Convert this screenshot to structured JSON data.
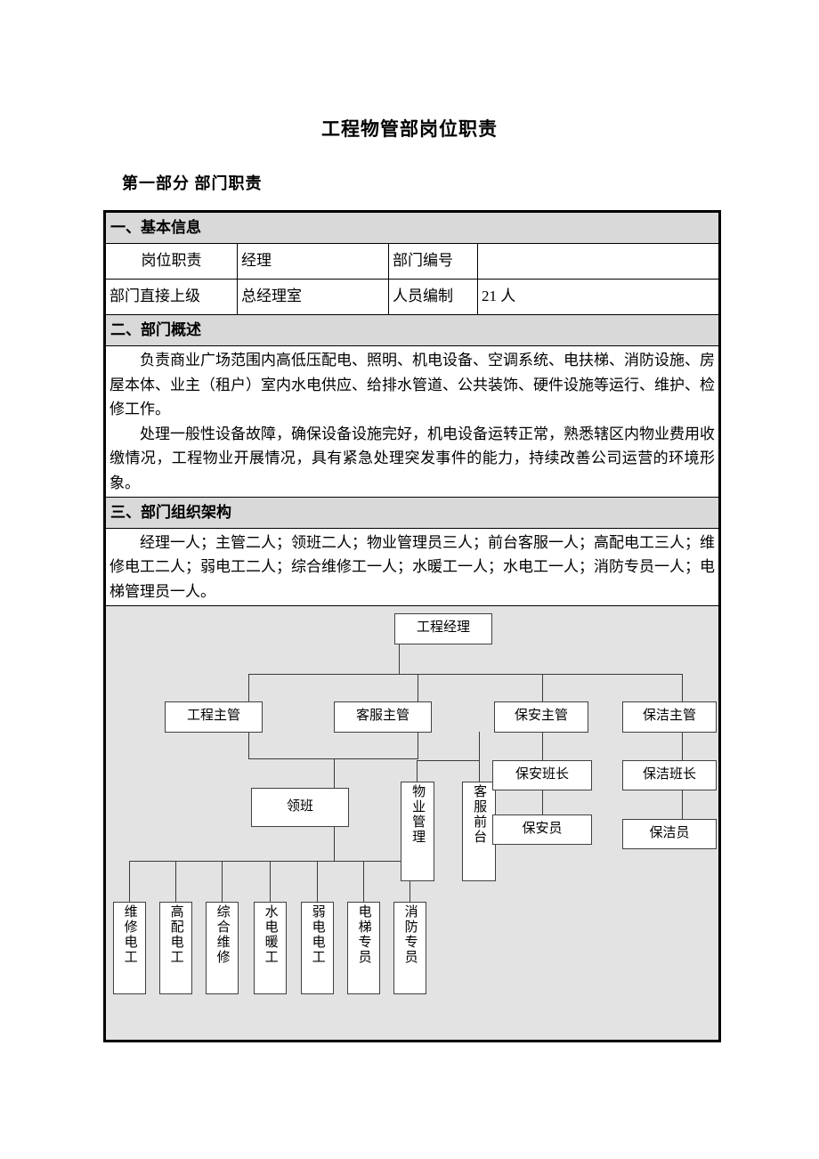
{
  "document": {
    "title": "工程物管部岗位职责",
    "part_heading": "第一部分 部门职责"
  },
  "sections": {
    "basic_info": {
      "heading": "一、基本信息",
      "rows": [
        {
          "label": "岗位职责",
          "value": "经理",
          "label2": "部门编号",
          "value2": ""
        },
        {
          "label": "部门直接上级",
          "value": "总经理室",
          "label2": "人员编制",
          "value2": "21 人"
        }
      ]
    },
    "overview": {
      "heading": "二、部门概述",
      "paragraphs": [
        "负责商业广场范围内高低压配电、照明、机电设备、空调系统、电扶梯、消防设施、房屋本体、业主（租户）室内水电供应、给排水管道、公共装饰、硬件设施等运行、维护、检修工作。",
        "处理一般性设备故障，确保设备设施完好，机电设备运转正常，熟悉辖区内物业费用收缴情况，工程物业开展情况，具有紧急处理突发事件的能力，持续改善公司运营的环境形象。"
      ]
    },
    "org_structure": {
      "heading": "三、部门组织架构",
      "staffing_text": "经理一人；主管二人；领班二人；物业管理员三人；前台客服一人；高配电工三人；维修电工二人；弱电工二人；综合维修工一人；水暖工一人；水电工一人；消防专员一人；电梯管理员一人。"
    }
  },
  "org_chart": {
    "background_color": "#e3e3e3",
    "nodes": [
      {
        "id": "manager",
        "label": "工程经理"
      },
      {
        "id": "eng-super",
        "label": "工程主管"
      },
      {
        "id": "cs-super",
        "label": "客服主管"
      },
      {
        "id": "sec-super",
        "label": "保安主管"
      },
      {
        "id": "clean-super",
        "label": "保洁主管"
      },
      {
        "id": "foreman",
        "label": "领班"
      },
      {
        "id": "prop-mgmt",
        "label": "物业管理"
      },
      {
        "id": "cs-front",
        "label": "客服前台"
      },
      {
        "id": "sec-lead",
        "label": "保安班长"
      },
      {
        "id": "sec-staff",
        "label": "保安员"
      },
      {
        "id": "clean-lead",
        "label": "保洁班长"
      },
      {
        "id": "clean-staff",
        "label": "保洁员"
      },
      {
        "id": "repair-elec",
        "label": "维修电工"
      },
      {
        "id": "hv-elec",
        "label": "高配电工"
      },
      {
        "id": "gen-repair",
        "label": "综合维修"
      },
      {
        "id": "plumb-heat",
        "label": "水电暖工"
      },
      {
        "id": "low-volt",
        "label": "弱电电工"
      },
      {
        "id": "elevator",
        "label": "电梯专员"
      },
      {
        "id": "fire-safety",
        "label": "消防专员"
      }
    ]
  }
}
